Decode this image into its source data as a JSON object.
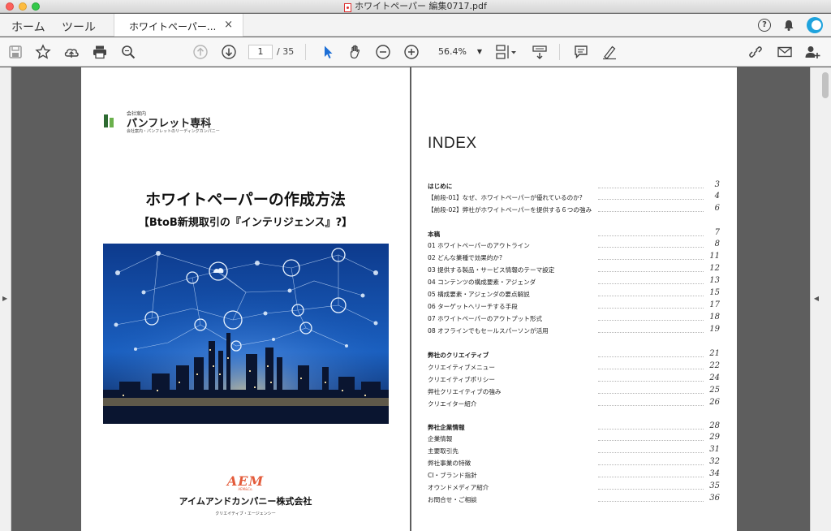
{
  "window": {
    "title": "ホワイトペーパー 編集0717.pdf"
  },
  "menu": {
    "home": "ホーム",
    "tools": "ツール"
  },
  "tab": {
    "label": "ホワイトペーパー...",
    "close": "×"
  },
  "toolbar": {
    "page_current": "1",
    "page_total": "/ 35",
    "zoom": "56.4%"
  },
  "cover": {
    "logo_small": "会社案内",
    "logo_main": "パンフレット専科",
    "logo_sub": "会社案内・パンフレットのリーディングカンパニー",
    "title": "ホワイトペーパーの作成方法",
    "subtitle": "【BtoB新規取引の『インテリジェンス』?】",
    "company_logo": "AEM",
    "company_logo_small": "AEM&Co.",
    "company_name": "アイムアンドカンパニー株式会社",
    "company_tagline": "クリエイティブ・エージェンシー"
  },
  "index": {
    "title": "INDEX",
    "entries": [
      {
        "label": "はじめに",
        "page": "3",
        "head": true
      },
      {
        "label": "【前段-01】なぜ、ホワイトペーパーが優れているのか?",
        "page": "4"
      },
      {
        "label": "【前段-02】弊社がホワイトペーパーを提供する６つの強み",
        "page": "6"
      },
      {
        "label": "本稿",
        "page": "7",
        "head": true
      },
      {
        "label": "01 ホワイトペーパーのアウトライン",
        "page": "8"
      },
      {
        "label": "02 どんな業種で効果的か?",
        "page": "11"
      },
      {
        "label": "03 提供する製品・サービス情報のテーマ設定",
        "page": "12"
      },
      {
        "label": "04 コンテンツの構成要素・アジェンダ",
        "page": "13"
      },
      {
        "label": "05 構成要素・アジェンダの要点解説",
        "page": "15"
      },
      {
        "label": "06 ターゲットへリーチする手段",
        "page": "17"
      },
      {
        "label": "07 ホワイトペーパーのアウトプット形式",
        "page": "18"
      },
      {
        "label": "08 オフラインでもセールスパーソンが活用",
        "page": "19"
      },
      {
        "label": "弊社のクリエイティブ",
        "page": "21",
        "head": true
      },
      {
        "label": "クリエイティブメニュー",
        "page": "22"
      },
      {
        "label": "クリエイティブポリシー",
        "page": "24"
      },
      {
        "label": "弊社クリエイティブの強み",
        "page": "25"
      },
      {
        "label": "クリエイター紹介",
        "page": "26"
      },
      {
        "label": "弊社企業情報",
        "page": "28",
        "head": true
      },
      {
        "label": "企業情報",
        "page": "29"
      },
      {
        "label": "主要取引先",
        "page": "31"
      },
      {
        "label": "弊社事業の特徴",
        "page": "32"
      },
      {
        "label": "CI・ブランド指針",
        "page": "34"
      },
      {
        "label": "オウンドメディア紹介",
        "page": "35"
      },
      {
        "label": "お問合せ・ご相談",
        "page": "36"
      }
    ]
  }
}
